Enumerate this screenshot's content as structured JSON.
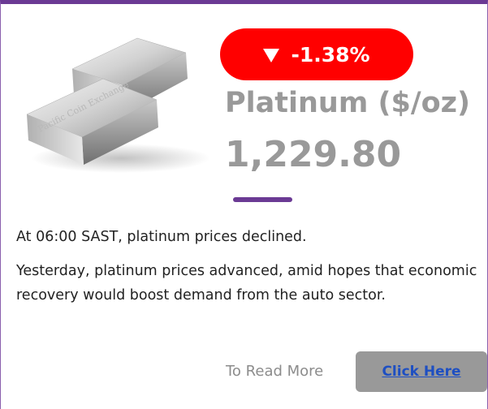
{
  "badge": {
    "change": "-1.38%",
    "direction_icon": "down-triangle-icon",
    "color": "#ff0000"
  },
  "header": {
    "title": "Platinum ($/oz)",
    "price": "1,229.80"
  },
  "image": {
    "engraving": "Pacific Coin Exchange"
  },
  "body": {
    "p1": "At 06:00 SAST, platinum prices declined.",
    "p2": "Yesterday, platinum prices advanced, amid hopes that economic recovery would boost demand from the auto sector."
  },
  "footer": {
    "read_more": "To Read More",
    "button_label": "Click Here"
  },
  "colors": {
    "accent": "#6b3a94",
    "text_muted": "#999999",
    "button_bg": "#999999",
    "link": "#1e4fc2"
  }
}
